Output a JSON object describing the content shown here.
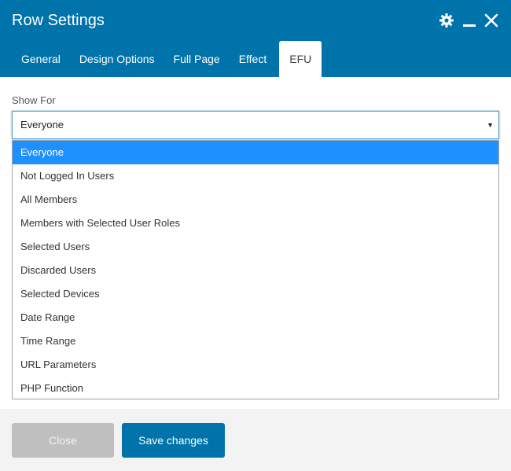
{
  "window": {
    "title": "Row Settings",
    "controls": [
      {
        "name": "gear-icon"
      },
      {
        "name": "minimize-icon"
      },
      {
        "name": "close-icon"
      }
    ]
  },
  "tabs": [
    {
      "label": "General",
      "active": false
    },
    {
      "label": "Design Options",
      "active": false
    },
    {
      "label": "Full Page",
      "active": false
    },
    {
      "label": "Effect",
      "active": false
    },
    {
      "label": "EFU",
      "active": true
    }
  ],
  "field": {
    "label": "Show For",
    "value": "Everyone",
    "options": [
      "Everyone",
      "Not Logged In Users",
      "All Members",
      "Members with Selected User Roles",
      "Selected Users",
      "Discarded Users",
      "Selected Devices",
      "Date Range",
      "Time Range",
      "URL Parameters",
      "PHP Function"
    ],
    "highlighted_index": 0
  },
  "footer": {
    "close_label": "Close",
    "save_label": "Save changes"
  },
  "colors": {
    "header": "#0073aa",
    "highlight": "#1e90ff",
    "close_button": "#bfbfbf",
    "save_button": "#0073aa"
  }
}
